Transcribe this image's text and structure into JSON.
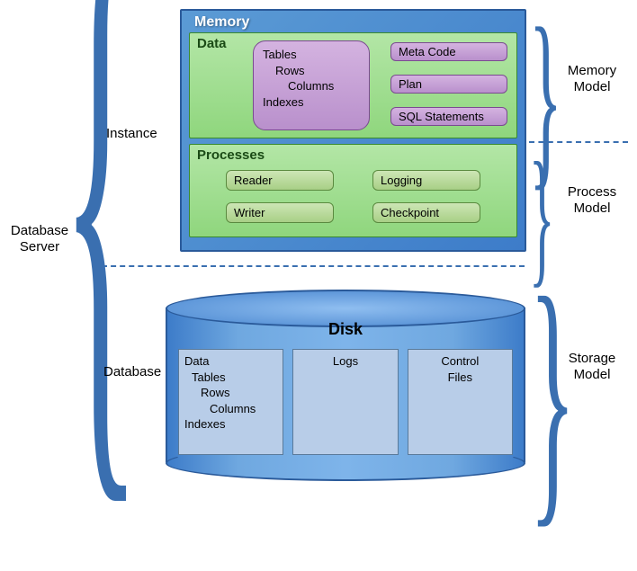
{
  "root_label": "Database\nServer",
  "instance_label": "Instance",
  "database_label": "Database",
  "memory": {
    "title": "Memory",
    "data": {
      "title": "Data",
      "tables": {
        "l1": "Tables",
        "l2": "Rows",
        "l3": "Columns",
        "l4": "Indexes"
      },
      "meta": "Meta Code",
      "plan": "Plan",
      "sql": "SQL Statements"
    },
    "processes": {
      "title": "Processes",
      "reader": "Reader",
      "writer": "Writer",
      "logging": "Logging",
      "checkpoint": "Checkpoint"
    }
  },
  "disk": {
    "title": "Disk",
    "data": {
      "h": "Data",
      "l1": "Tables",
      "l2": "Rows",
      "l3": "Columns",
      "l4": "Indexes"
    },
    "logs": "Logs",
    "control": "Control\nFiles"
  },
  "right": {
    "mem": "Memory\nModel",
    "proc": "Process\nModel",
    "stor": "Storage\nModel"
  }
}
